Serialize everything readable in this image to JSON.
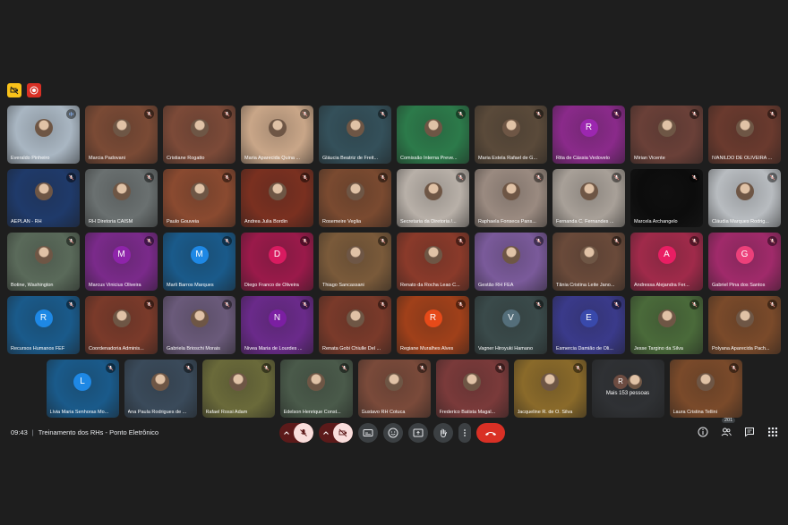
{
  "meeting": {
    "time": "09:43",
    "title": "Treinamento dos RHs - Ponto Eletrônico"
  },
  "participant_count": "201",
  "rows": [
    [
      {
        "name": "Everaldo Pinheiro",
        "bg": "#a9b6c2",
        "avatar": "photo",
        "speaking": true
      },
      {
        "name": "Marcia Padovani",
        "bg": "#7a4a35",
        "avatar": "photo"
      },
      {
        "name": "Cristiane Rogatto",
        "bg": "#7c4a38",
        "avatar": "photo"
      },
      {
        "name": "Maria Aparecida Quina ...",
        "bg": "#c9a688",
        "avatar": "photo"
      },
      {
        "name": "Gláucia Beatriz de Freit...",
        "bg": "#34505a",
        "avatar": "photo"
      },
      {
        "name": "Comissão Interna Preve...",
        "bg": "#2c7a4a",
        "avatar": "photo"
      },
      {
        "name": "Maria Estela Rafael de G...",
        "bg": "#5a4a3a",
        "avatar": "photo"
      },
      {
        "name": "Rita de Cássia Vedovelo",
        "bg": "#8a2a8a",
        "avatar": "letter",
        "letter": "R",
        "avcolor": "#9c27b0"
      },
      {
        "name": "Mirian Vicente",
        "bg": "#6a4038",
        "avatar": "photo"
      },
      {
        "name": "IVANILDO DE OLIVEIRA ...",
        "bg": "#6a3a2e",
        "avatar": "photo"
      }
    ],
    [
      {
        "name": "AEPLAN - RH",
        "bg": "#1f3a6a",
        "avatar": "photo"
      },
      {
        "name": "RH Diretoria CAISM",
        "bg": "#6a7070",
        "avatar": "photo"
      },
      {
        "name": "Paulo Gouveia",
        "bg": "#8a4a30",
        "avatar": "photo"
      },
      {
        "name": "Andrea Julia Bordin",
        "bg": "#7a3020",
        "avatar": "photo"
      },
      {
        "name": "Rosemeire Veglia",
        "bg": "#7a4a30",
        "avatar": "photo"
      },
      {
        "name": "Secretaria da Diretoria /...",
        "bg": "#b8b0a8",
        "avatar": "photo"
      },
      {
        "name": "Raphaela Fonseca Pans...",
        "bg": "#9a8a80",
        "avatar": "photo"
      },
      {
        "name": "Fernanda C. Fernandes ...",
        "bg": "#a8a098",
        "avatar": "photo"
      },
      {
        "name": "Marcela Archangelo",
        "bg": "#0c0c0c",
        "avatar": "none"
      },
      {
        "name": "Cláudia Marques Rodrig...",
        "bg": "#b8bcc0",
        "avatar": "photo"
      }
    ],
    [
      {
        "name": "Botine, Washington",
        "bg": "#5a6a5a",
        "avatar": "photo"
      },
      {
        "name": "Marcus Vinicius Oliveira",
        "bg": "#7a2a8a",
        "avatar": "letter",
        "letter": "M",
        "avcolor": "#8e24aa"
      },
      {
        "name": "Marli Barros Marques",
        "bg": "#1a5a8a",
        "avatar": "letter",
        "letter": "M",
        "avcolor": "#1e88e5"
      },
      {
        "name": "Diego Franco de Oliveira",
        "bg": "#9a1a4a",
        "avatar": "letter",
        "letter": "D",
        "avcolor": "#d81b60"
      },
      {
        "name": "Thiago Sancassani",
        "bg": "#7a5a3a",
        "avatar": "photo"
      },
      {
        "name": "Renato da Rocha Leao C...",
        "bg": "#8a3a2a",
        "avatar": "photo"
      },
      {
        "name": "Gestão RH FEA",
        "bg": "#7a5a9a",
        "avatar": "photo"
      },
      {
        "name": "Tânia Cristina Leite Jano...",
        "bg": "#6a4a3a",
        "avatar": "photo"
      },
      {
        "name": "Andressa Alejandra Fer...",
        "bg": "#a02a4a",
        "avatar": "letter",
        "letter": "A",
        "avcolor": "#e91e63"
      },
      {
        "name": "Gabriel Pina dos Santos",
        "bg": "#a02a6a",
        "avatar": "letter",
        "letter": "G",
        "avcolor": "#ec407a"
      }
    ],
    [
      {
        "name": "Recursos Humanos FEF",
        "bg": "#1a5a8a",
        "avatar": "letter",
        "letter": "R",
        "avcolor": "#1e88e5"
      },
      {
        "name": "Coordenadoria Adminis...",
        "bg": "#7a3a2a",
        "avatar": "photo"
      },
      {
        "name": "Gabriela Brioschi Morais",
        "bg": "#6a5a7a",
        "avatar": "photo"
      },
      {
        "name": "Nivea Maria de Lourdes ...",
        "bg": "#6a2a8a",
        "avatar": "letter",
        "letter": "N",
        "avcolor": "#7b1fa2"
      },
      {
        "name": "Renata Gobi Chiulle Del ...",
        "bg": "#7a3a2a",
        "avatar": "photo"
      },
      {
        "name": "Regiane Muralhes Alves",
        "bg": "#a0401a",
        "avatar": "letter",
        "letter": "R",
        "avcolor": "#e64a19"
      },
      {
        "name": "Vagner Hiroyuki Hamano",
        "bg": "#3a4a4a",
        "avatar": "letter",
        "letter": "V",
        "avcolor": "#546e7a"
      },
      {
        "name": "Esmercia Damião de Oli...",
        "bg": "#3a3a8a",
        "avatar": "letter",
        "letter": "E",
        "avcolor": "#3949ab"
      },
      {
        "name": "Jesse Targino da Silva",
        "bg": "#4a6a3a",
        "avatar": "photo"
      },
      {
        "name": "Polyana Aparecida Pach...",
        "bg": "#7a4a2a",
        "avatar": "photo"
      }
    ],
    [
      {
        "name": "Lívia Maria Senhoras Mo...",
        "bg": "#1a5a8a",
        "avatar": "letter",
        "letter": "L",
        "avcolor": "#1e88e5"
      },
      {
        "name": "Ana Paula Rodrigues de ...",
        "bg": "#3a4a5a",
        "avatar": "photo"
      },
      {
        "name": "Rafael Rossi Adam",
        "bg": "#6a6a3a",
        "avatar": "photo"
      },
      {
        "name": "Edelson Henrique Const...",
        "bg": "#4a5a4a",
        "avatar": "photo"
      },
      {
        "name": "Gustavo RH Cotuca",
        "bg": "#7a4a3a",
        "avatar": "photo"
      },
      {
        "name": "Frederico Batista Magal...",
        "bg": "#7a3a3a",
        "avatar": "photo"
      },
      {
        "name": "Jacqueline R. de O. Silva",
        "bg": "#8a6a2a",
        "avatar": "photo"
      },
      {
        "name": "",
        "bg": "#2f3134",
        "avatar": "more",
        "more_label": "Mais 153 pessoas",
        "more_letter": "R"
      },
      {
        "name": "Laura Cristina Tellini",
        "bg": "#7a4a2a",
        "avatar": "photo"
      }
    ]
  ],
  "icons": {
    "top_left": [
      "no-camera-icon",
      "record-icon"
    ],
    "controls": [
      "chevron-up-icon",
      "mic-off-icon",
      "chevron-up-icon",
      "camera-off-icon",
      "captions-icon",
      "emoji-icon",
      "present-icon",
      "raise-hand-icon",
      "more-options-icon",
      "end-call-icon"
    ],
    "right": [
      "info-icon",
      "people-icon",
      "chat-icon",
      "activities-icon"
    ]
  }
}
